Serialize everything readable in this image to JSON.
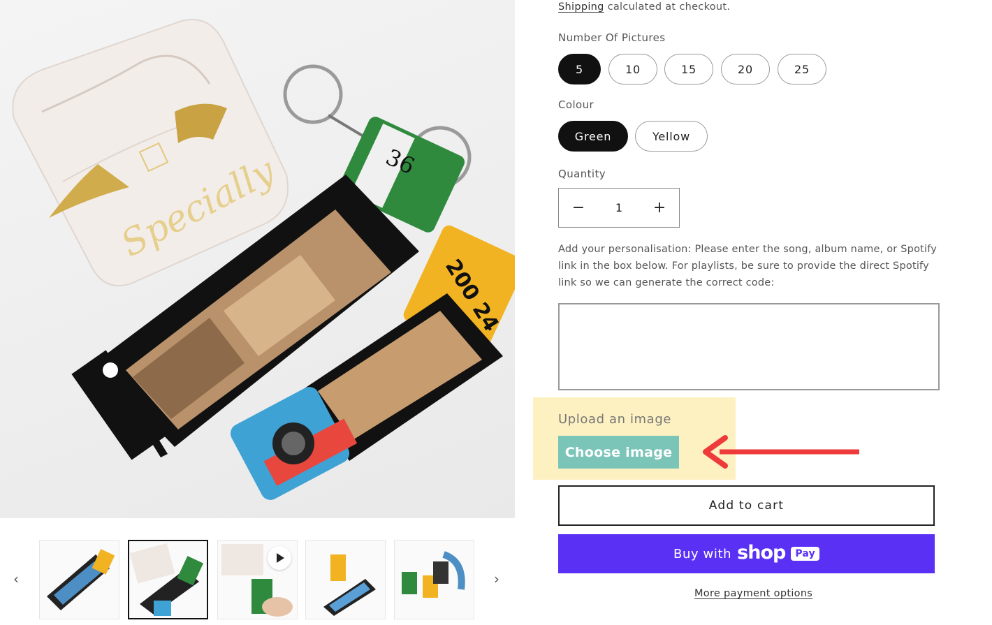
{
  "gallery": {
    "main_image_alt": "Film roll keychains with cat photos",
    "prev_icon": "chevron-left-icon",
    "next_icon": "chevron-right-icon",
    "play_icon": "play-icon"
  },
  "shipping": {
    "link": "Shipping",
    "text": " calculated at checkout."
  },
  "pictures": {
    "label": "Number Of Pictures",
    "options": [
      "5",
      "10",
      "15",
      "20",
      "25"
    ],
    "selected": "5"
  },
  "colour": {
    "label": "Colour",
    "options": [
      "Green",
      "Yellow"
    ],
    "selected": "Green"
  },
  "quantity": {
    "label": "Quantity",
    "value": "1",
    "minus": "−",
    "plus": "+"
  },
  "personalisation": {
    "text": "Add your personalisation: Please enter the song, album name, or Spotify link in the box below. For playlists, be sure to provide the direct Spotify link so we can generate the correct code:",
    "value": ""
  },
  "upload": {
    "label": "Upload an image",
    "button": "Choose image",
    "highlight_color": "#fdf1c1",
    "button_color": "#7bc4b8",
    "arrow_color": "#ee3a3a"
  },
  "actions": {
    "add_to_cart": "Add to cart",
    "buy_with": "Buy with",
    "shop_word": "shop",
    "pay_badge": "Pay",
    "more_options": "More payment options",
    "shop_pay_color": "#5a31f4"
  }
}
